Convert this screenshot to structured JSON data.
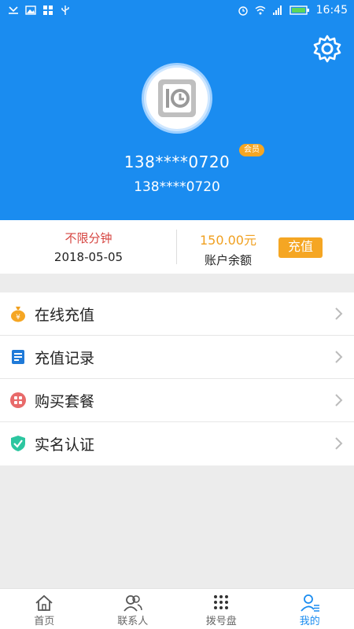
{
  "status_bar": {
    "time": "16:45"
  },
  "header": {
    "badge": "会员",
    "phone_main": "138****0720",
    "phone_sub": "138****0720"
  },
  "balance": {
    "plan": "不限分钟",
    "date": "2018-05-05",
    "amount": "150.00元",
    "amount_label": "账户余额",
    "recharge_label": "充值"
  },
  "menu": {
    "items": [
      {
        "label": "在线充值",
        "icon": "money-bag-icon"
      },
      {
        "label": "充值记录",
        "icon": "receipt-icon"
      },
      {
        "label": "购买套餐",
        "icon": "package-icon"
      },
      {
        "label": "实名认证",
        "icon": "verified-shield-icon"
      }
    ]
  },
  "tabs": [
    {
      "label": "首页",
      "icon": "home-icon"
    },
    {
      "label": "联系人",
      "icon": "contacts-icon"
    },
    {
      "label": "拨号盘",
      "icon": "dialpad-icon"
    },
    {
      "label": "我的",
      "icon": "profile-icon",
      "active": true
    }
  ],
  "colors": {
    "primary": "#1a8cf0",
    "accent": "#f5a623",
    "plan": "#d64541"
  }
}
